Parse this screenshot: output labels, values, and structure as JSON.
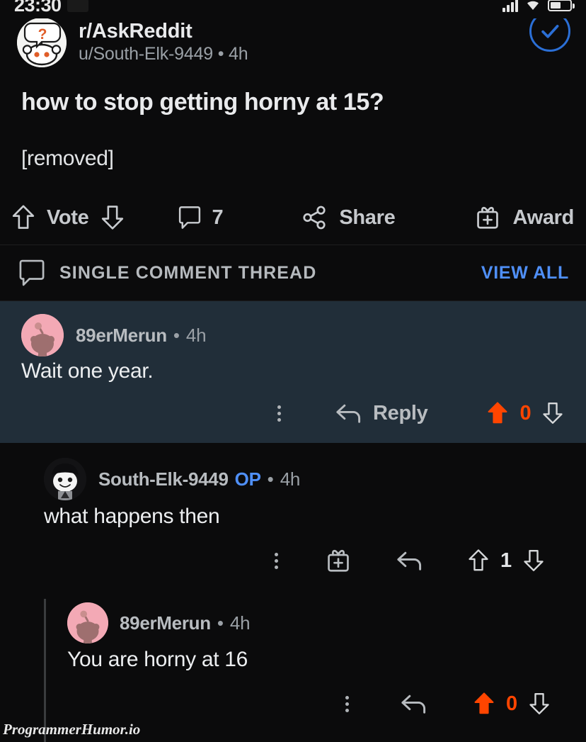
{
  "status_bar": {
    "time": "23:30",
    "icons": [
      "message-icon",
      "signal-icon",
      "wifi-icon",
      "battery-icon"
    ]
  },
  "post": {
    "subreddit": "r/AskReddit",
    "author_line": "u/South-Elk-9449 • 4h",
    "title": "how to stop getting horny at 15?",
    "body": "[removed]",
    "join_state": "subscribed",
    "actions": {
      "vote_label": "Vote",
      "comment_count": "7",
      "share_label": "Share",
      "award_label": "Award"
    }
  },
  "thread_bar": {
    "label": "SINGLE COMMENT THREAD",
    "view_all": "VIEW ALL"
  },
  "comments": [
    {
      "user": "89erMerun",
      "op": "",
      "separator": "•",
      "age": "4h",
      "body": "Wait one year.",
      "reply_label": "Reply",
      "score": "0",
      "upvoted": "true"
    },
    {
      "user": "South-Elk-9449",
      "op": "OP",
      "separator": "•",
      "age": "4h",
      "body": "what happens then",
      "reply_label": "",
      "score": "1",
      "upvoted": "false"
    },
    {
      "user": "89erMerun",
      "op": "",
      "separator": "•",
      "age": "4h",
      "body": "You are horny at 16",
      "reply_label": "",
      "score": "0",
      "upvoted": "true"
    }
  ],
  "watermark": "ProgrammerHumor.io",
  "colors": {
    "background": "#0b0b0c",
    "highlight": "#212e39",
    "accent_blue": "#4f8ff7",
    "upvote_orange": "#ff4500",
    "avatar_pink": "#f3a9b5"
  }
}
